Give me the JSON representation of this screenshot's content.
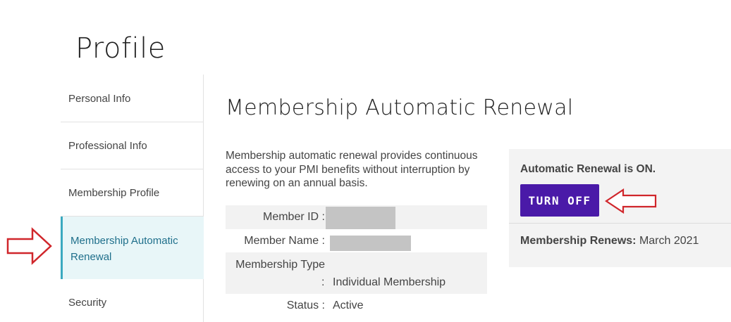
{
  "page": {
    "title": "Profile"
  },
  "sidebar": {
    "items": [
      {
        "label": "Personal Info"
      },
      {
        "label": "Professional Info"
      },
      {
        "label": "Membership Profile"
      },
      {
        "label": "Membership Automatic Renewal",
        "active": true
      },
      {
        "label": "Security"
      }
    ]
  },
  "main": {
    "section_title": "Membership Automatic Renewal",
    "description": "Membership automatic renewal provides continuous access to your PMI benefits without interruption by renewing on an annual basis.",
    "details": {
      "member_id_label": "Member ID :",
      "member_name_label": "Member Name :",
      "membership_type_label": "Membership Type",
      "membership_type_colon": ":",
      "membership_type_value": "Individual Membership",
      "status_label": "Status :",
      "status_value": "Active"
    }
  },
  "renewal_panel": {
    "status_text": "Automatic Renewal is ON.",
    "turn_off_label": "TURN OFF",
    "renews_label": "Membership Renews:",
    "renews_value": "March 2021"
  },
  "colors": {
    "button_purple": "#4a1aa8",
    "active_item_bg": "#e8f6f8",
    "annotation_red": "#d0262b"
  }
}
